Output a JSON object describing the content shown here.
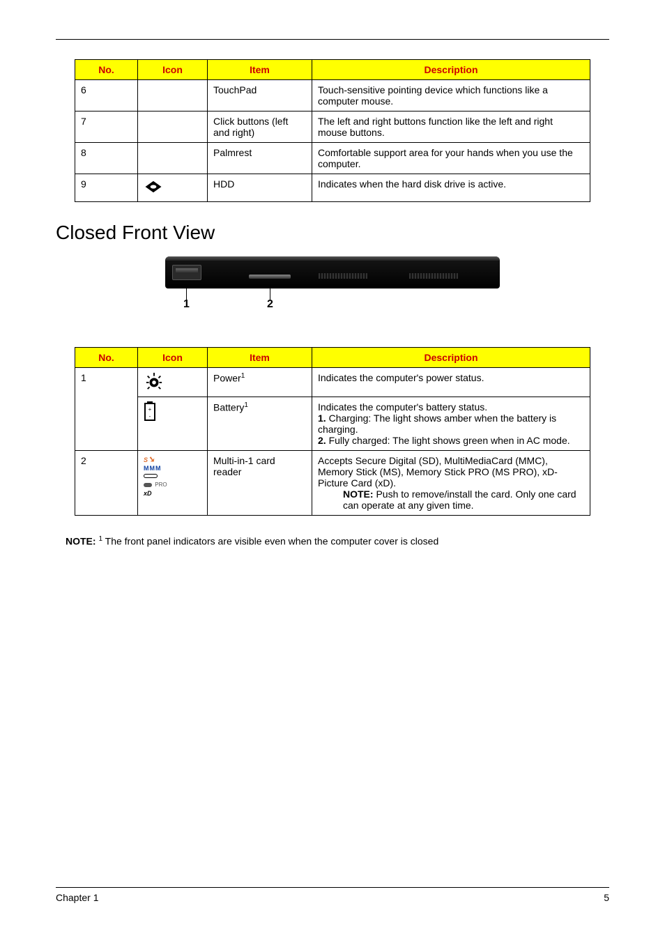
{
  "headers": {
    "no": "No.",
    "icon": "Icon",
    "item": "Item",
    "description": "Description"
  },
  "table1": {
    "rows": [
      {
        "no": "6",
        "item": "TouchPad",
        "desc": "Touch-sensitive pointing device which functions like a computer mouse."
      },
      {
        "no": "7",
        "item": "Click buttons (left and right)",
        "desc": "The left and right buttons function like the left and right mouse buttons."
      },
      {
        "no": "8",
        "item": "Palmrest",
        "desc": "Comfortable support area for your hands when you use the computer."
      },
      {
        "no": "9",
        "item": "HDD",
        "desc": "Indicates when the hard disk drive is active."
      }
    ]
  },
  "section_title": "Closed Front View",
  "callouts": {
    "one": "1",
    "two": "2"
  },
  "table2": {
    "rows": [
      {
        "no": "1",
        "item": "Power",
        "sup": "1",
        "desc": "Indicates the computer's power status."
      },
      {
        "no": "",
        "item": "Battery",
        "sup": "1",
        "desc_lines": {
          "l1": "Indicates the computer's battery status.",
          "l2a": "1.",
          "l2b": " Charging: The light shows amber when the battery is charging.",
          "l3a": "2.",
          "l3b": " Fully charged: The light shows green when in AC mode."
        }
      },
      {
        "no": "2",
        "item": "Multi-in-1 card reader",
        "desc_lines": {
          "l1": "Accepts Secure Digital (SD), MultiMediaCard (MMC), Memory Stick (MS), Memory Stick PRO (MS PRO), xD-Picture Card (xD).",
          "note_label": "NOTE:",
          "note_body": " Push to remove/install the card. Only one card can operate at any given time."
        }
      }
    ]
  },
  "note": {
    "label": "NOTE:",
    "sup": "1",
    "body": " The front panel indicators are visible even when the computer cover is closed"
  },
  "card_icon": {
    "l1": "S",
    "l2": "MMM",
    "l4": "PRO",
    "l5": "xD"
  },
  "footer": {
    "left": "Chapter 1",
    "right": "5"
  }
}
